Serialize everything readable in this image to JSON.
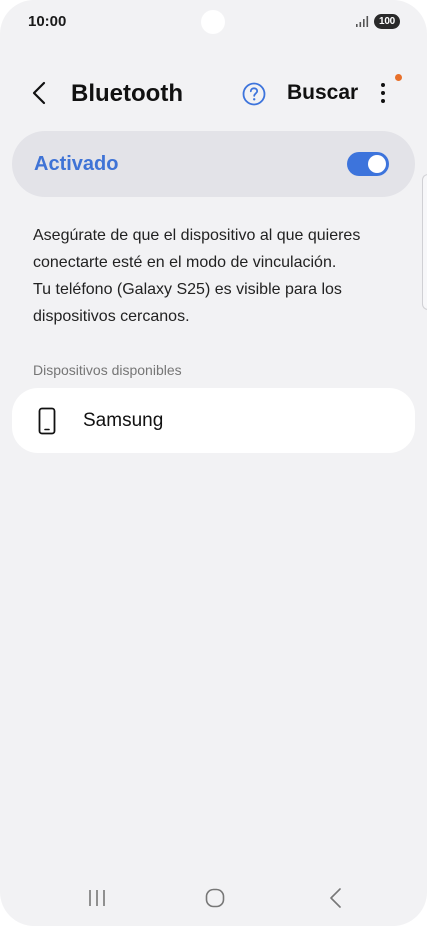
{
  "status_bar": {
    "time": "10:00",
    "battery": "100",
    "icons": [
      "signal-icon",
      "battery-icon"
    ]
  },
  "header": {
    "title": "Bluetooth",
    "search_label": "Buscar",
    "icons": [
      "back-icon",
      "help-icon",
      "more-options-icon"
    ],
    "notification_dot_color": "#e8702a"
  },
  "master_toggle": {
    "label": "Activado",
    "state": "on",
    "accent_color": "#3d74dc"
  },
  "description": {
    "line1": "Asegúrate de que el dispositivo al que quieres conectarte esté en el modo de vinculación.",
    "line2": "Tu teléfono (Galaxy S25) es visible para los dispositivos cercanos."
  },
  "available_devices": {
    "header": "Dispositivos disponibles",
    "items": [
      {
        "name": "Samsung",
        "icon": "smartphone-icon"
      }
    ]
  },
  "nav_bar": {
    "icons": [
      "recent-apps-icon",
      "home-icon",
      "back-nav-icon"
    ]
  }
}
